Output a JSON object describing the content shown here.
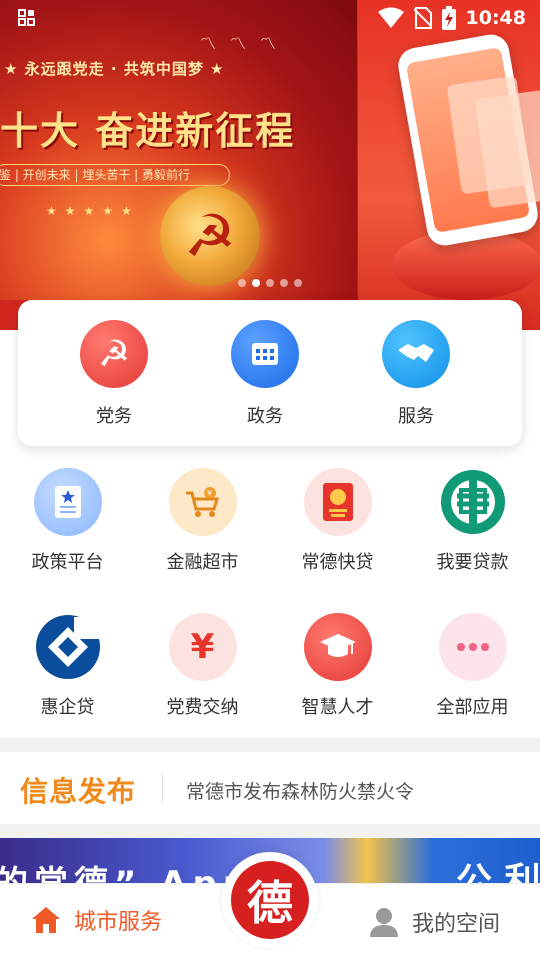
{
  "status_bar": {
    "time": "10:48"
  },
  "banner": {
    "slogan": "★ 永远跟党走 · 共筑中国梦 ★",
    "headline": "十大 奋进新征程",
    "subtitle": "鉴 | 开创未来 | 埋头苦干 | 勇毅前行",
    "stars": "★★★★★",
    "dots_count": 5,
    "active_dot": 1
  },
  "main_services": [
    {
      "label": "党务",
      "icon": "party-emblem-icon",
      "color": "#f0504a"
    },
    {
      "label": "政务",
      "icon": "government-building-icon",
      "color": "#2a7cf5"
    },
    {
      "label": "服务",
      "icon": "handshake-icon",
      "color": "#1e9cf0"
    }
  ],
  "apps": [
    {
      "label": "政策平台",
      "icon": "policy-document-icon"
    },
    {
      "label": "金融超市",
      "icon": "shopping-cart-icon"
    },
    {
      "label": "常德快贷",
      "icon": "red-envelope-icon"
    },
    {
      "label": "我要贷款",
      "icon": "agricultural-bank-icon"
    },
    {
      "label": "惠企贷",
      "icon": "ccb-bank-icon"
    },
    {
      "label": "党费交纳",
      "icon": "yuan-icon"
    },
    {
      "label": "智慧人才",
      "icon": "graduation-cap-icon"
    },
    {
      "label": "全部应用",
      "icon": "more-dots-icon"
    }
  ],
  "info": {
    "title": "信息发布",
    "headline": "常德市发布森林防火禁火令"
  },
  "promo": {
    "text_left": "的常德” App",
    "text_right": "公 利"
  },
  "bottom_nav": {
    "left_label": "城市服务",
    "center_label": "德",
    "right_label": "我的空间"
  },
  "colors": {
    "accent_orange": "#f05a28",
    "info_title": "#f08a1c",
    "brand_red": "#d62020"
  }
}
